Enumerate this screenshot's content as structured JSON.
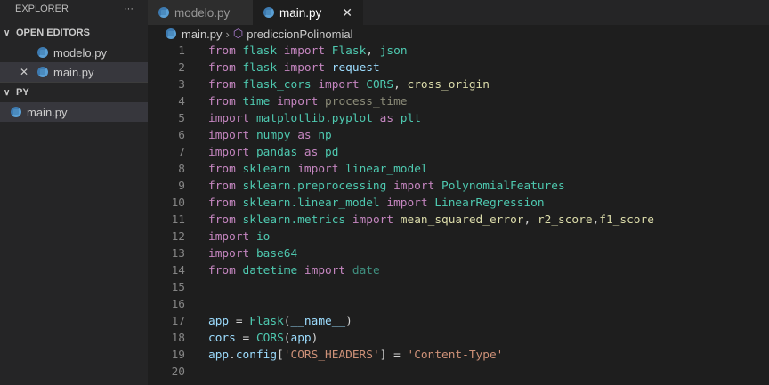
{
  "sidebar": {
    "title": "EXPLORER",
    "more": "···",
    "open_editors": "OPEN EDITORS",
    "open_files": [
      "modelo.py",
      "main.py"
    ],
    "close": "✕",
    "folder": "PY",
    "folder_files": [
      "main.py"
    ]
  },
  "tabs": [
    {
      "label": "modelo.py"
    },
    {
      "label": "main.py",
      "close": "✕"
    }
  ],
  "breadcrumb": {
    "file": "main.py",
    "sep": "›",
    "symbol": "prediccionPolinomial"
  },
  "code": [
    [
      [
        "from",
        "kw"
      ],
      [
        " ",
        "pl"
      ],
      [
        "flask",
        "mod"
      ],
      [
        " ",
        "pl"
      ],
      [
        "import",
        "kw"
      ],
      [
        " ",
        "pl"
      ],
      [
        "Flask",
        "cls"
      ],
      [
        ", ",
        "pl"
      ],
      [
        "json",
        "mod"
      ]
    ],
    [
      [
        "from",
        "kw"
      ],
      [
        " ",
        "pl"
      ],
      [
        "flask",
        "mod"
      ],
      [
        " ",
        "pl"
      ],
      [
        "import",
        "kw"
      ],
      [
        " ",
        "pl"
      ],
      [
        "request",
        "var"
      ]
    ],
    [
      [
        "from",
        "kw"
      ],
      [
        " ",
        "pl"
      ],
      [
        "flask_cors",
        "mod"
      ],
      [
        " ",
        "pl"
      ],
      [
        "import",
        "kw"
      ],
      [
        " ",
        "pl"
      ],
      [
        "CORS",
        "cls"
      ],
      [
        ", ",
        "pl"
      ],
      [
        "cross_origin",
        "fn"
      ]
    ],
    [
      [
        "from",
        "kw"
      ],
      [
        " ",
        "pl"
      ],
      [
        "time",
        "mod"
      ],
      [
        " ",
        "pl"
      ],
      [
        "import",
        "kw"
      ],
      [
        " ",
        "pl"
      ],
      [
        "process_time",
        "dim"
      ]
    ],
    [
      [
        "import",
        "kw"
      ],
      [
        " ",
        "pl"
      ],
      [
        "matplotlib.pyplot",
        "mod"
      ],
      [
        " ",
        "pl"
      ],
      [
        "as",
        "kw"
      ],
      [
        " ",
        "pl"
      ],
      [
        "plt",
        "mod"
      ]
    ],
    [
      [
        "import",
        "kw"
      ],
      [
        " ",
        "pl"
      ],
      [
        "numpy",
        "mod"
      ],
      [
        " ",
        "pl"
      ],
      [
        "as",
        "kw"
      ],
      [
        " ",
        "pl"
      ],
      [
        "np",
        "mod"
      ]
    ],
    [
      [
        "import",
        "kw"
      ],
      [
        " ",
        "pl"
      ],
      [
        "pandas",
        "mod"
      ],
      [
        " ",
        "pl"
      ],
      [
        "as",
        "kw"
      ],
      [
        " ",
        "pl"
      ],
      [
        "pd",
        "mod"
      ]
    ],
    [
      [
        "from",
        "kw"
      ],
      [
        " ",
        "pl"
      ],
      [
        "sklearn",
        "mod"
      ],
      [
        " ",
        "pl"
      ],
      [
        "import",
        "kw"
      ],
      [
        " ",
        "pl"
      ],
      [
        "linear_model",
        "mod"
      ]
    ],
    [
      [
        "from",
        "kw"
      ],
      [
        " ",
        "pl"
      ],
      [
        "sklearn.preprocessing",
        "mod"
      ],
      [
        " ",
        "pl"
      ],
      [
        "import",
        "kw"
      ],
      [
        " ",
        "pl"
      ],
      [
        "PolynomialFeatures",
        "cls"
      ]
    ],
    [
      [
        "from",
        "kw"
      ],
      [
        " ",
        "pl"
      ],
      [
        "sklearn.linear_model",
        "mod"
      ],
      [
        " ",
        "pl"
      ],
      [
        "import",
        "kw"
      ],
      [
        " ",
        "pl"
      ],
      [
        "LinearRegression",
        "cls"
      ]
    ],
    [
      [
        "from",
        "kw"
      ],
      [
        " ",
        "pl"
      ],
      [
        "sklearn.metrics",
        "mod"
      ],
      [
        " ",
        "pl"
      ],
      [
        "import",
        "kw"
      ],
      [
        " ",
        "pl"
      ],
      [
        "mean_squared_error",
        "fn"
      ],
      [
        ", ",
        "pl"
      ],
      [
        "r2_score",
        "fn"
      ],
      [
        ",",
        "pl"
      ],
      [
        "f1_score",
        "fn"
      ]
    ],
    [
      [
        "import",
        "kw"
      ],
      [
        " ",
        "pl"
      ],
      [
        "io",
        "mod"
      ]
    ],
    [
      [
        "import",
        "kw"
      ],
      [
        " ",
        "pl"
      ],
      [
        "base64",
        "mod"
      ]
    ],
    [
      [
        "from",
        "kw"
      ],
      [
        " ",
        "pl"
      ],
      [
        "datetime",
        "mod"
      ],
      [
        " ",
        "pl"
      ],
      [
        "import",
        "kw"
      ],
      [
        " ",
        "pl"
      ],
      [
        "date",
        "dimc"
      ]
    ],
    [],
    [],
    [
      [
        "app",
        "var"
      ],
      [
        " = ",
        "pl"
      ],
      [
        "Flask",
        "cls"
      ],
      [
        "(",
        "pl"
      ],
      [
        "__name__",
        "var"
      ],
      [
        ")",
        "pl"
      ]
    ],
    [
      [
        "cors",
        "var"
      ],
      [
        " = ",
        "pl"
      ],
      [
        "CORS",
        "cls"
      ],
      [
        "(",
        "pl"
      ],
      [
        "app",
        "var"
      ],
      [
        ")",
        "pl"
      ]
    ],
    [
      [
        "app",
        "var"
      ],
      [
        ".",
        "pl"
      ],
      [
        "config",
        "var"
      ],
      [
        "[",
        "pl"
      ],
      [
        "'CORS_HEADERS'",
        "str"
      ],
      [
        "] = ",
        "pl"
      ],
      [
        "'Content-Type'",
        "str"
      ]
    ],
    []
  ]
}
